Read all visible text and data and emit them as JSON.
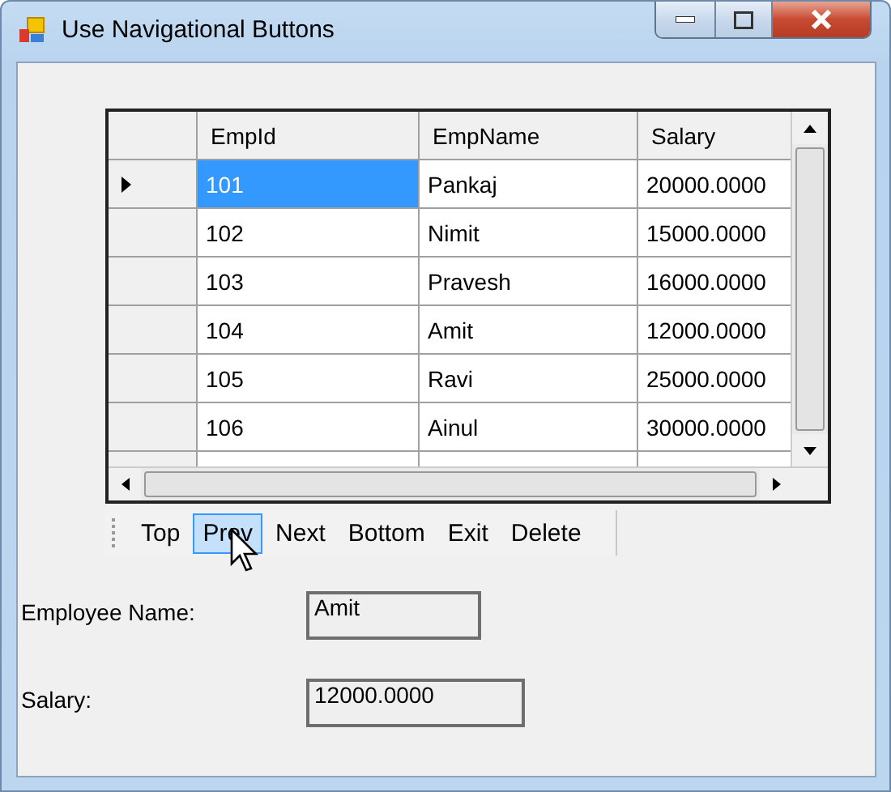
{
  "window": {
    "title": "Use Navigational Buttons"
  },
  "table": {
    "columns": [
      "EmpId",
      "EmpName",
      "Salary"
    ],
    "rows": [
      {
        "cells": [
          "101",
          "Pankaj",
          "20000.0000"
        ],
        "selected": true
      },
      {
        "cells": [
          "102",
          "Nimit",
          "15000.0000"
        ],
        "selected": false
      },
      {
        "cells": [
          "103",
          "Pravesh",
          "16000.0000"
        ],
        "selected": false
      },
      {
        "cells": [
          "104",
          "Amit",
          "12000.0000"
        ],
        "selected": false
      },
      {
        "cells": [
          "105",
          "Ravi",
          "25000.0000"
        ],
        "selected": false
      },
      {
        "cells": [
          "106",
          "Ainul",
          "30000.0000"
        ],
        "selected": false
      }
    ]
  },
  "toolbar": [
    {
      "label": "Top",
      "selected": false
    },
    {
      "label": "Prev",
      "selected": true
    },
    {
      "label": "Next",
      "selected": false
    },
    {
      "label": "Bottom",
      "selected": false
    },
    {
      "label": "Exit",
      "selected": false
    },
    {
      "label": "Delete",
      "selected": false
    }
  ],
  "fields": [
    {
      "label": "Employee Name:",
      "value": "Amit"
    },
    {
      "label": "Salary:",
      "value": "12000.0000"
    }
  ]
}
